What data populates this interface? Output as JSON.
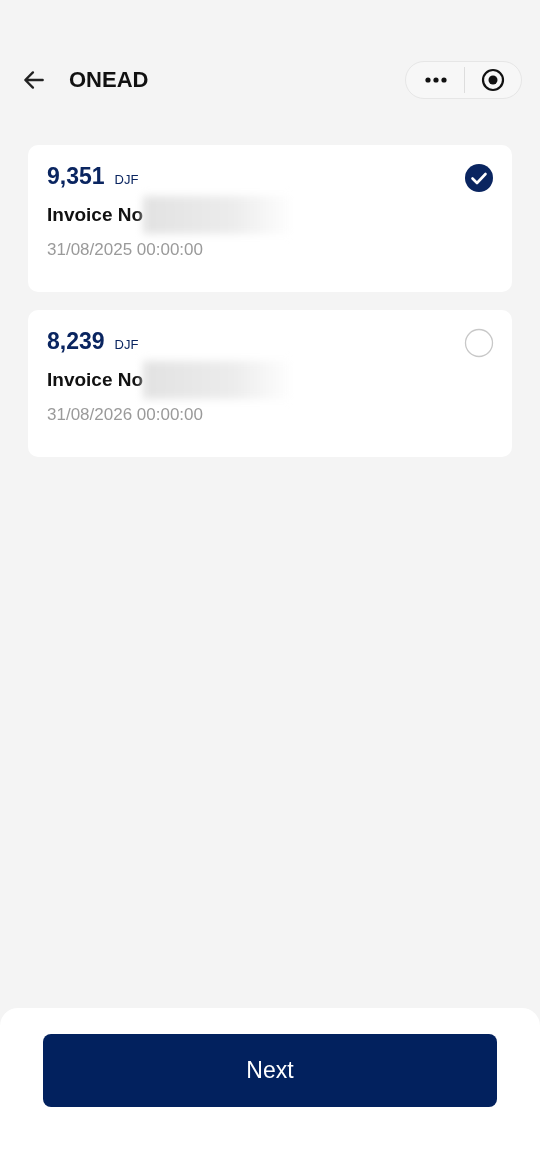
{
  "header": {
    "title": "ONEAD"
  },
  "invoices": [
    {
      "amount": "9,351",
      "currency": "DJF",
      "label": "Invoice No",
      "date": "31/08/2025 00:00:00",
      "selected": true
    },
    {
      "amount": "8,239",
      "currency": "DJF",
      "label": "Invoice No",
      "date": "31/08/2026 00:00:00",
      "selected": false
    }
  ],
  "footer": {
    "button": "Next"
  }
}
